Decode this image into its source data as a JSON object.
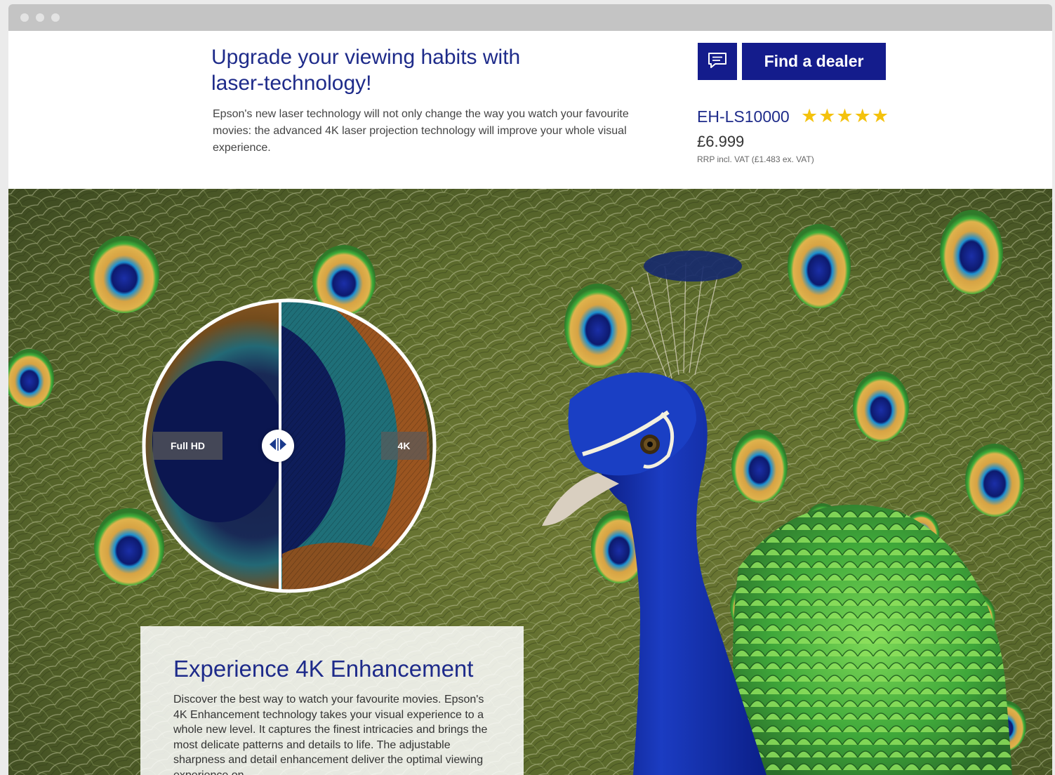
{
  "browser": {
    "controls": [
      "close-dot",
      "minimize-dot",
      "maximize-dot"
    ]
  },
  "header": {
    "headline": "Upgrade your viewing habits with laser-technology!",
    "intro": "Epson's new laser technology will not only change the way you watch your favourite movies: the advanced 4K laser projection technology will improve your whole visual experience."
  },
  "product": {
    "model": "EH-LS10000",
    "stars": "★★★★★",
    "rating": 5,
    "price": "£6.999",
    "vat_note": "RRP incl. VAT (£1.483 ex. VAT)",
    "dealer_button": "Find a dealer",
    "chat_icon": "chat-bubble-icon"
  },
  "hero": {
    "comparison": {
      "left_label": "Full HD",
      "right_label": "4K",
      "handle_icon": "left-right-arrows-icon"
    },
    "panel": {
      "title": "Experience 4K Enhancement",
      "body": "Discover the best way to watch your favourite movies. Epson's 4K Enhancement technology takes your visual experience to a whole new level. It captures the finest intricacies and brings the most delicate patterns and details to life. The adjustable sharpness and detail enhancement deliver the optimal viewing experience on"
    }
  },
  "colors": {
    "brand_blue": "#141c8c",
    "headline_blue": "#1e2b8a",
    "star_yellow": "#f4c20d"
  }
}
